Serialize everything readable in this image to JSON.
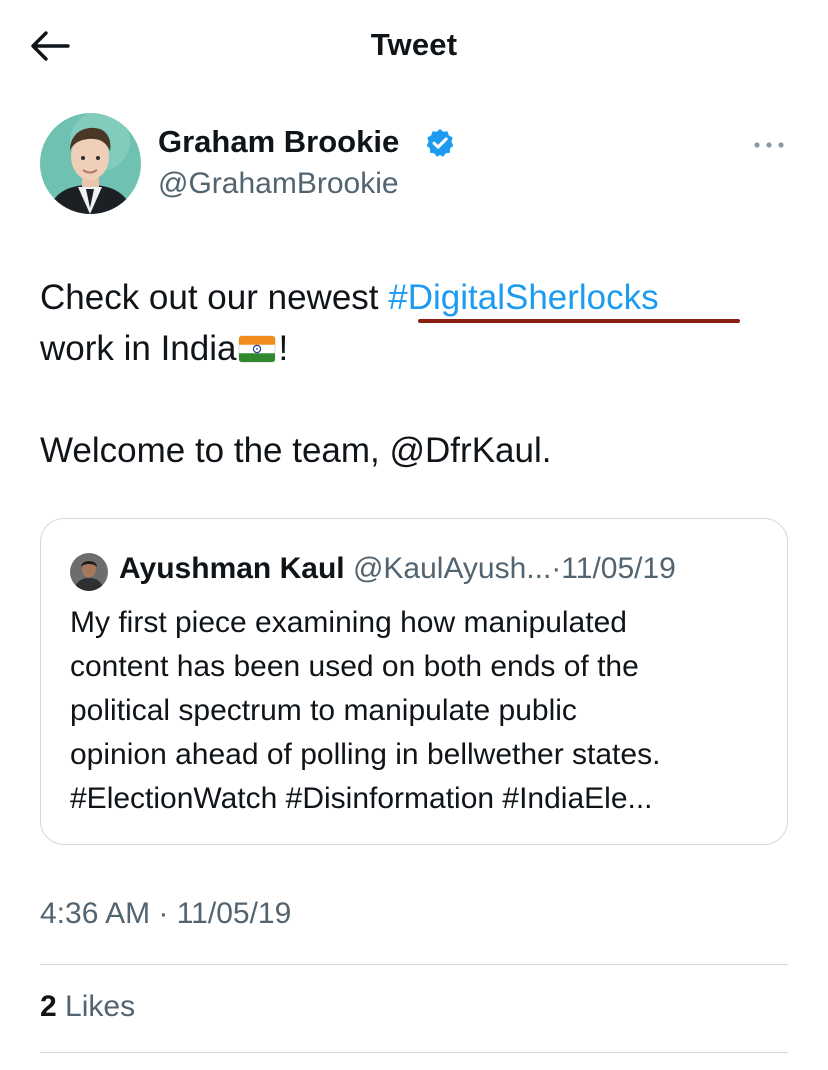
{
  "header": {
    "title": "Tweet",
    "back_icon": "arrow-left-icon"
  },
  "author": {
    "name": "Graham Brookie",
    "handle": "@GrahamBrookie",
    "verified_icon": "verified-badge-icon",
    "more_icon": "more-horizontal-icon"
  },
  "tweet": {
    "line1_text": "Check out our newest ",
    "hashtag": "#DigitalSherlocks",
    "line2_text": "work in India",
    "flag": "india-flag-icon",
    "line2_end": "!",
    "line3_text": "Welcome to the team, @DfrKaul."
  },
  "quote": {
    "name": "Ayushman Kaul",
    "handle": "@KaulAyush...",
    "separator": "·",
    "date": "11/05/19",
    "lines": [
      "My first piece examining how manipulated",
      "content has been used on both ends of the",
      "political spectrum to manipulate public",
      "opinion ahead of polling in bellwether states.",
      "#ElectionWatch #Disinformation #IndiaEle..."
    ]
  },
  "meta": {
    "timestamp": "4:36 AM · 11/05/19",
    "likes_count": "2",
    "likes_label": "Likes"
  },
  "colors": {
    "link": "#1d9bf0",
    "secondary_text": "#536471",
    "border": "#cfd9de",
    "annotation_underline": "#8b1f12"
  }
}
